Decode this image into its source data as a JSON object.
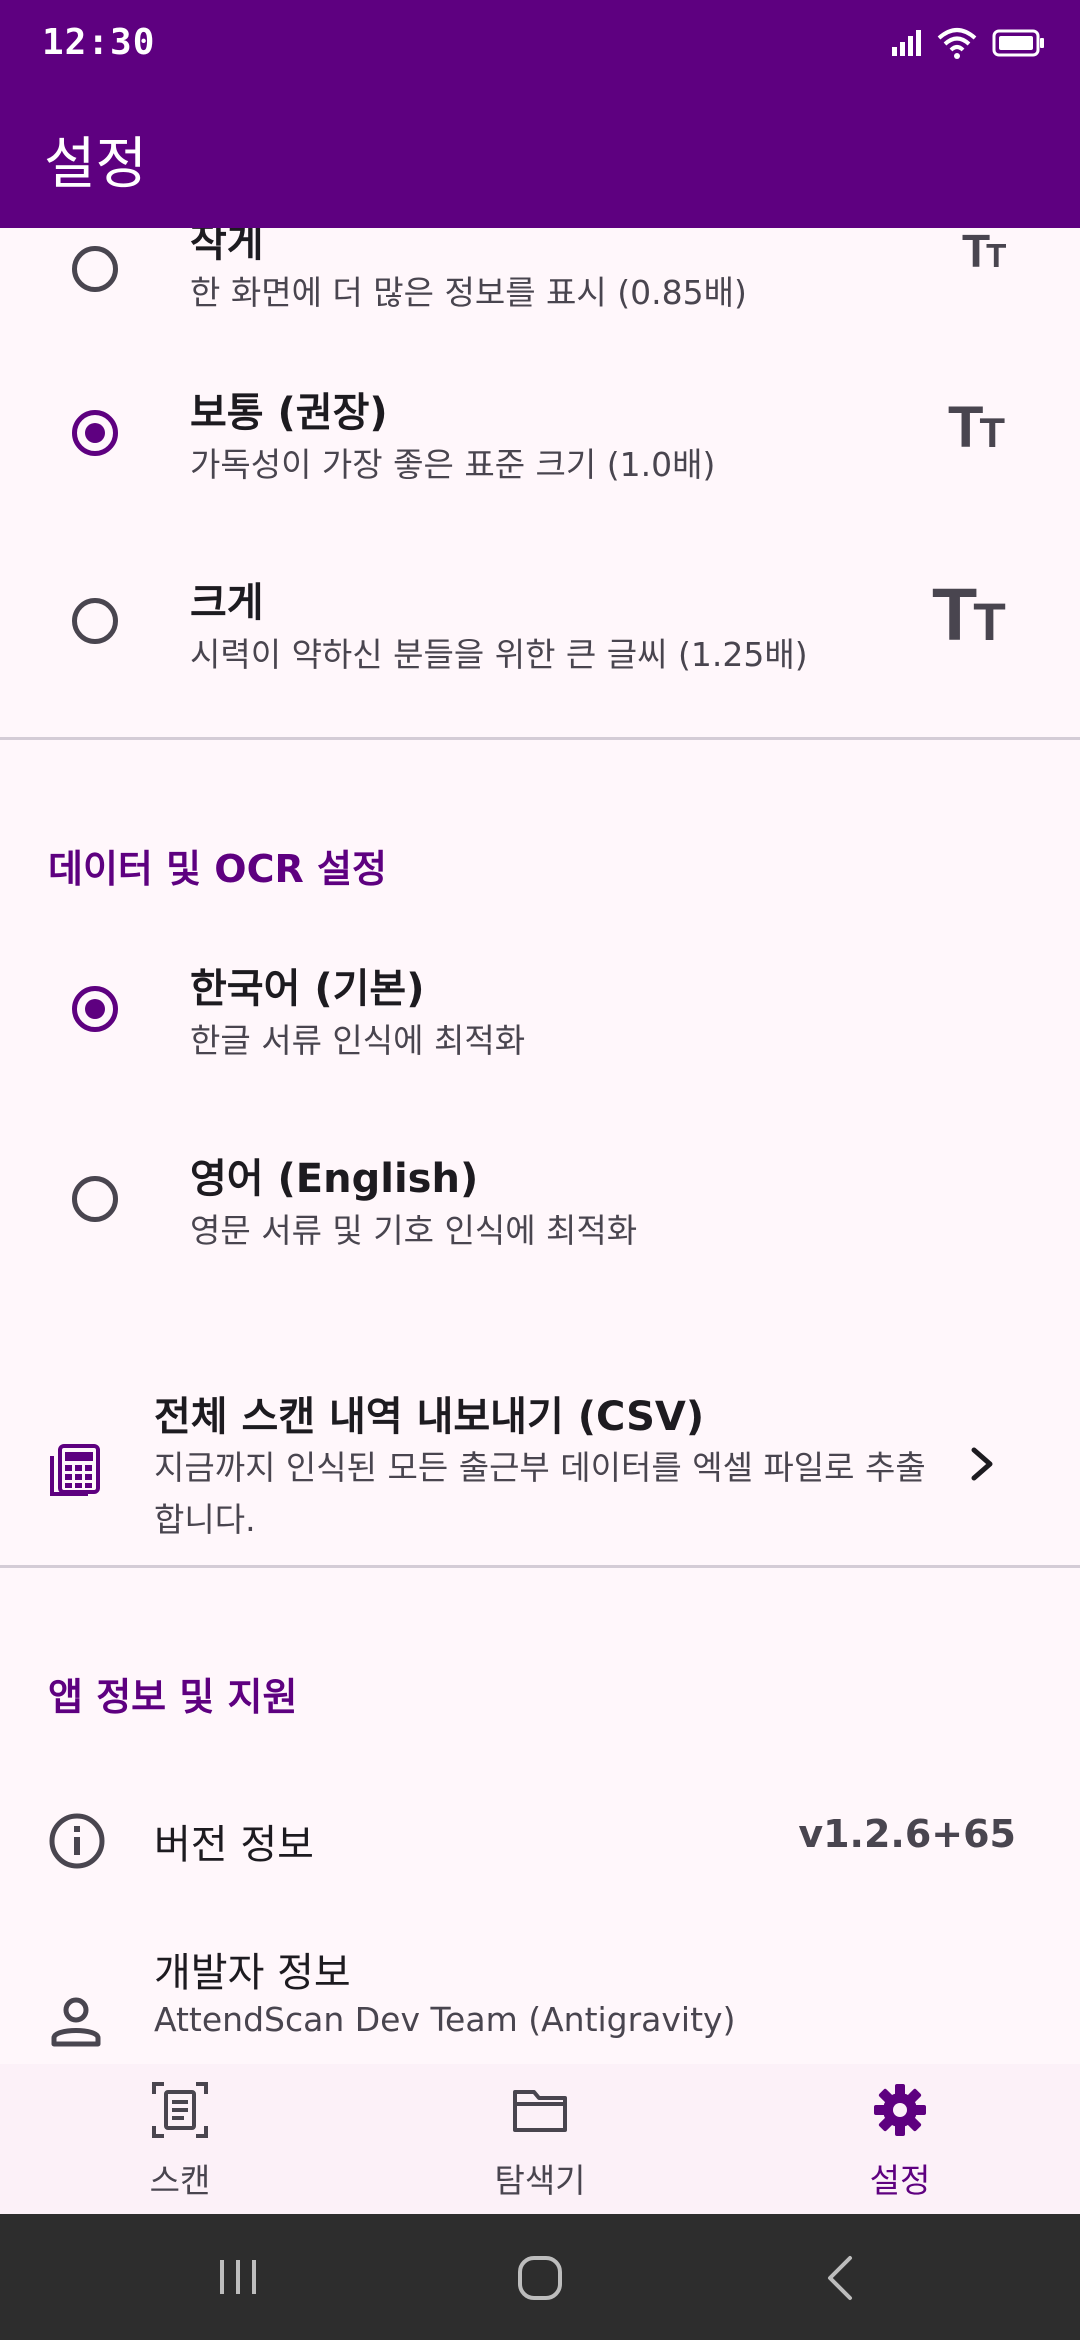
{
  "status": {
    "time": "12:30"
  },
  "app_bar": {
    "title": "설정"
  },
  "font_size": {
    "partial_title": "작게",
    "small_sub": "한 화면에 더 많은 정보를 표시 (0.85배)",
    "normal_title": "보통 (권장)",
    "normal_sub": "가독성이 가장 좋은 표준 크기 (1.0배)",
    "large_title": "크게",
    "large_sub": "시력이 약하신 분들을 위한 큰 글씨 (1.25배)",
    "selected": "normal",
    "icon": "text-size-icon",
    "icon_glyph_big": "T",
    "icon_glyph_small": "T"
  },
  "data_section": {
    "header": "데이터 및 OCR 설정",
    "korean_title": "한국어 (기본)",
    "korean_sub": "한글 서류 인식에 최적화",
    "english_title": "영어 (English)",
    "english_sub": "영문 서류 및 기호 인식에 최적화",
    "selected": "korean",
    "export_title": "전체 스캔 내역 내보내기 (CSV)",
    "export_sub": "지금까지 인식된 모든 출근부 데이터를 엑셀 파일로 추출합니다."
  },
  "app_info": {
    "header": "앱 정보 및 지원",
    "version_label": "버전 정보",
    "version_value": "v1.2.6+65",
    "developer_label": "개발자 정보",
    "developer_sub": "AttendScan Dev Team (Antigravity)"
  },
  "bottom_nav": {
    "items": [
      {
        "label": "스캔",
        "icon": "scan-document-icon"
      },
      {
        "label": "탐색기",
        "icon": "folder-icon"
      },
      {
        "label": "설정",
        "icon": "gear-icon"
      }
    ],
    "active_index": 2
  },
  "colors": {
    "primary": "#5E0080",
    "background": "#FFF7FB",
    "text": "#1D1B20",
    "subtext": "#49454F"
  }
}
